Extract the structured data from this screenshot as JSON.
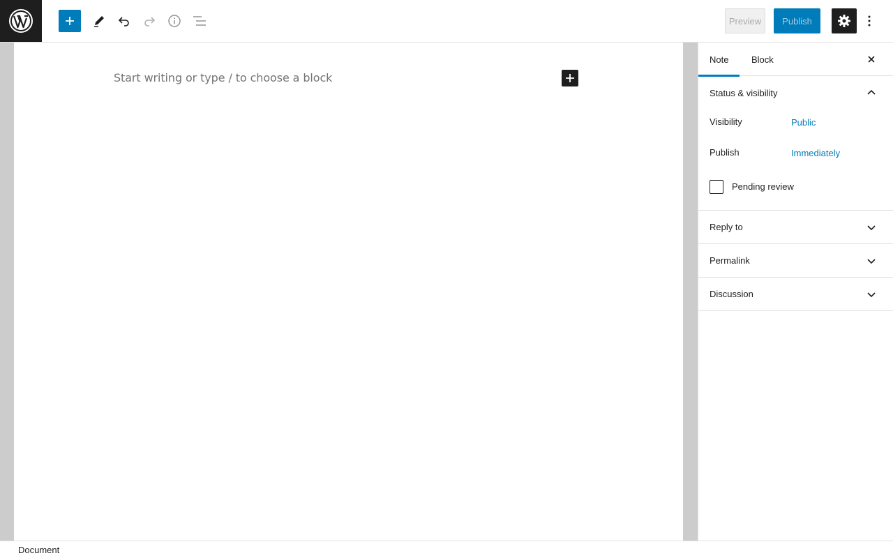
{
  "header": {
    "logo_icon": "wordpress-logo-icon",
    "toolbar": {
      "inserter_icon": "plus-icon",
      "edit_icon": "pencil-icon",
      "undo_icon": "undo-icon",
      "redo_icon": "redo-icon",
      "info_icon": "info-icon",
      "list_view_icon": "list-view-icon"
    },
    "preview_label": "Preview",
    "publish_label": "Publish",
    "settings_icon": "gear-icon",
    "more_icon": "vertical-dots-icon"
  },
  "editor": {
    "placeholder": "Start writing or type / to choose a block",
    "add_block_icon": "plus-icon"
  },
  "sidebar": {
    "tabs": [
      {
        "label": "Note",
        "active": true
      },
      {
        "label": "Block",
        "active": false
      }
    ],
    "close_icon": "close-icon",
    "status_panel": {
      "title": "Status & visibility",
      "expanded": true,
      "visibility_label": "Visibility",
      "visibility_value": "Public",
      "publish_label": "Publish",
      "publish_value": "Immediately",
      "pending_label": "Pending review",
      "pending_checked": false
    },
    "panels": [
      {
        "title": "Reply to",
        "expanded": false
      },
      {
        "title": "Permalink",
        "expanded": false
      },
      {
        "title": "Discussion",
        "expanded": false
      }
    ]
  },
  "footer": {
    "breadcrumb": "Document"
  },
  "colors": {
    "accent": "#007cba",
    "dark": "#1e1e1e",
    "canvas_bg": "#cccccc",
    "placeholder": "#757575"
  }
}
